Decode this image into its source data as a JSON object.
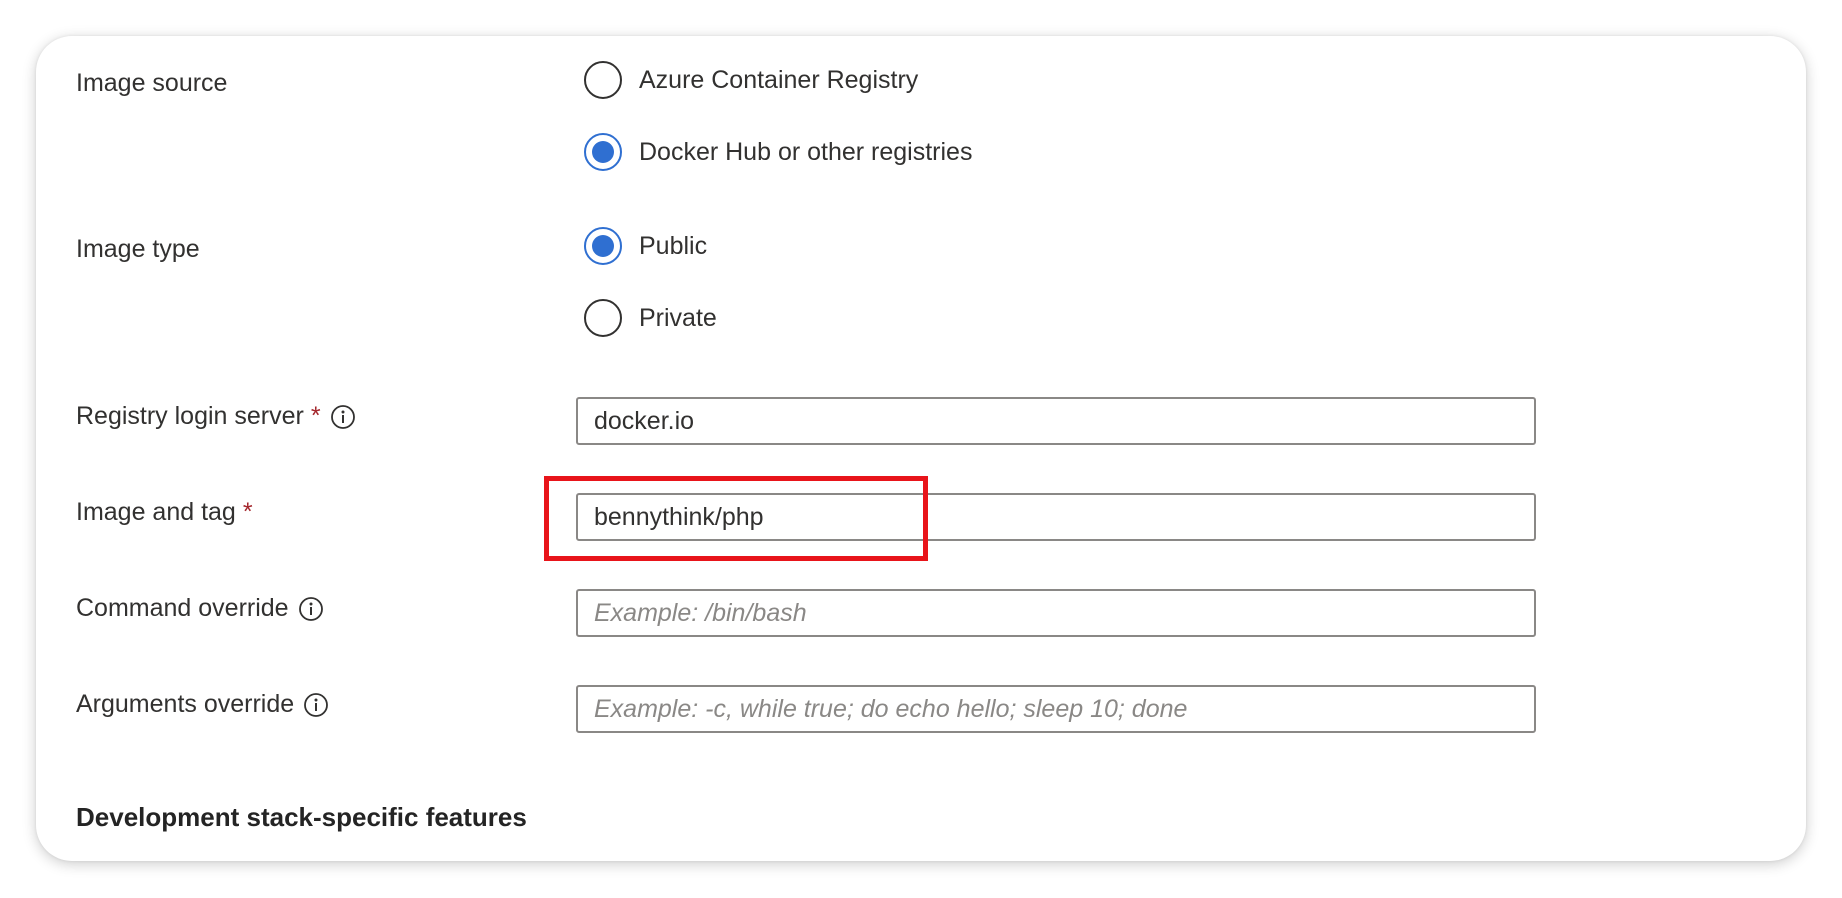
{
  "form": {
    "image_source": {
      "label": "Image source",
      "options": [
        {
          "label": "Azure Container Registry",
          "selected": false
        },
        {
          "label": "Docker Hub or other registries",
          "selected": true
        }
      ]
    },
    "image_type": {
      "label": "Image type",
      "options": [
        {
          "label": "Public",
          "selected": true
        },
        {
          "label": "Private",
          "selected": false
        }
      ]
    },
    "registry_login_server": {
      "label": "Registry login server",
      "required_marker": "*",
      "value": "docker.io"
    },
    "image_and_tag": {
      "label": "Image and tag",
      "required_marker": "*",
      "value": "bennythink/php"
    },
    "command_override": {
      "label": "Command override",
      "value": "",
      "placeholder": "Example: /bin/bash"
    },
    "arguments_override": {
      "label": "Arguments override",
      "value": "",
      "placeholder": "Example: -c, while true; do echo hello; sleep 10; done"
    }
  },
  "section": {
    "heading": "Development stack-specific features"
  },
  "colors": {
    "accent": "#2f6fd1",
    "required": "#a4262c",
    "highlight": "#e8141a",
    "input_border": "#8a8886"
  }
}
